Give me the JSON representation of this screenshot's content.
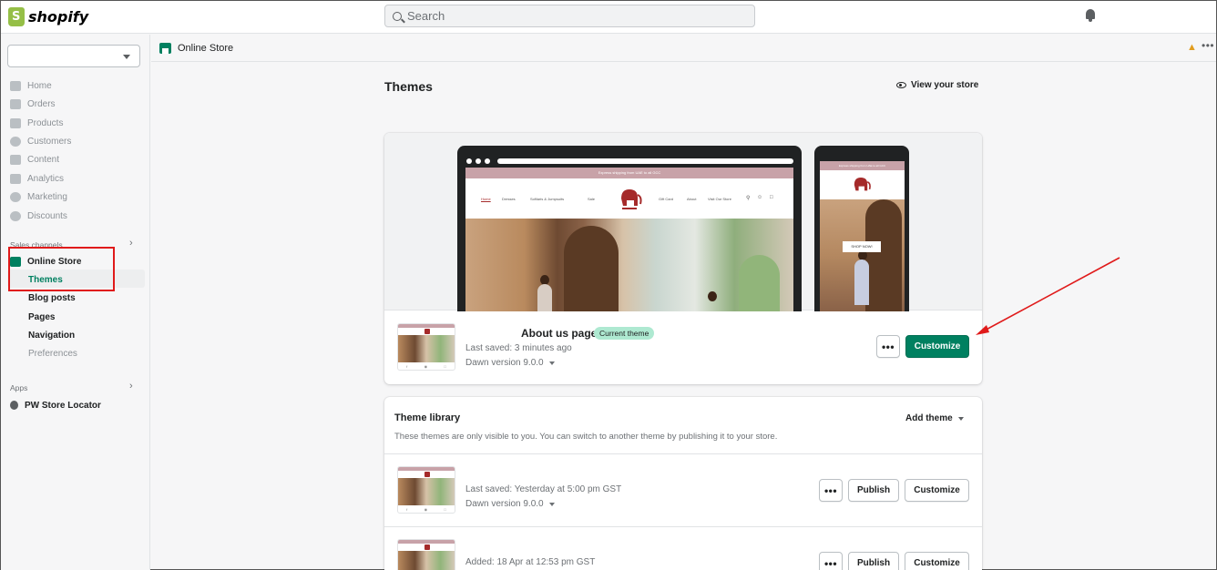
{
  "topbar": {
    "logo_text": "shopify",
    "search_placeholder": "Search"
  },
  "sidebar": {
    "store_select_value": "",
    "items": [
      {
        "label": "Home",
        "icon": "home-icon"
      },
      {
        "label": "Orders",
        "icon": "orders-icon"
      },
      {
        "label": "Products",
        "icon": "tag-icon"
      },
      {
        "label": "Customers",
        "icon": "person-icon"
      },
      {
        "label": "Content",
        "icon": "content-icon"
      },
      {
        "label": "Analytics",
        "icon": "bar-chart-icon"
      },
      {
        "label": "Marketing",
        "icon": "target-icon"
      },
      {
        "label": "Discounts",
        "icon": "discount-icon"
      }
    ],
    "sales_channels_label": "Sales channels",
    "online_store_label": "Online Store",
    "sub_items": [
      "Themes",
      "Blog posts",
      "Pages",
      "Navigation",
      "Preferences"
    ],
    "apps_label": "Apps",
    "app_item": "PW Store Locator"
  },
  "breadcrumb": {
    "label": "Online Store"
  },
  "main": {
    "title": "Themes",
    "view_store": "View your store",
    "preview": {
      "promo_text": "Express shipping from UAE to all GCC",
      "nav_links": [
        "Home",
        "Dresses",
        "Sofilaris & Jumpsuits",
        "Sale"
      ],
      "nav_right": [
        "Gift Card",
        "About",
        "Visit Our Store"
      ],
      "phone_cta": "SHOP NOW!"
    },
    "current_theme": {
      "name": "About us page",
      "badge": "Current theme",
      "last_saved": "Last saved: 3 minutes ago",
      "version": "Dawn version 9.0.0",
      "customize_label": "Customize"
    },
    "library": {
      "title": "Theme library",
      "description": "These themes are only visible to you. You can switch to another theme by publishing it to your store.",
      "add_theme_label": "Add theme",
      "themes": [
        {
          "meta": "Last saved: Yesterday at 5:00 pm GST",
          "version": "Dawn version 9.0.0",
          "publish_label": "Publish",
          "customize_label": "Customize"
        },
        {
          "meta": "Added: 18 Apr at 12:53 pm GST",
          "version": "",
          "publish_label": "Publish",
          "customize_label": "Customize"
        }
      ]
    }
  },
  "colors": {
    "accent": "#008060",
    "badge_bg": "#aee9d1",
    "annotation": "#e01a1a"
  }
}
